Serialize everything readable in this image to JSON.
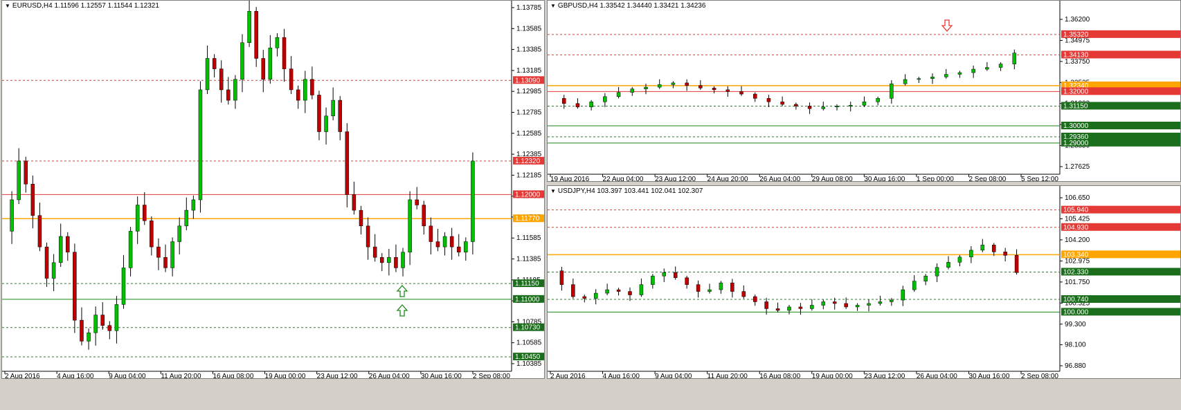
{
  "charts": [
    {
      "id": "eurusd",
      "title": "EURUSD,H4  1.11596 1.12557 1.11544 1.12321",
      "price_axis": [
        "1.13785",
        "1.13585",
        "1.13385",
        "1.13185",
        "1.12985",
        "1.12785",
        "1.12585",
        "1.12385",
        "1.12185",
        "1.11985",
        "1.11785",
        "1.11585",
        "1.11385",
        "1.11185",
        "1.10985",
        "1.10785",
        "1.10585",
        "1.10385"
      ],
      "time_axis": [
        "2 Aug 2016",
        "4 Aug 16:00",
        "9 Aug 04:00",
        "11 Aug 20:00",
        "16 Aug 08:00",
        "19 Aug 00:00",
        "23 Aug 12:00",
        "26 Aug 04:00",
        "30 Aug 16:00",
        "2 Sep 08:00"
      ],
      "levels": [
        {
          "value": "1.13090",
          "color": "#e53935",
          "style": "dashed",
          "tag_bg": "#e53935"
        },
        {
          "value": "1.12320",
          "color": "#e53935",
          "style": "dashed",
          "tag_bg": "#e53935"
        },
        {
          "value": "1.12000",
          "color": "#e53935",
          "style": "solid",
          "tag_bg": "#e53935"
        },
        {
          "value": "1.11770",
          "color": "#ffa500",
          "style": "solid",
          "tag_bg": "#ffa500"
        },
        {
          "value": "1.11150",
          "color": "#1b8a1b",
          "style": "dashed",
          "tag_bg": "#1b6e1b"
        },
        {
          "value": "1.11000",
          "color": "#1b8a1b",
          "style": "solid",
          "tag_bg": "#1b6e1b"
        },
        {
          "value": "1.10730",
          "color": "#1b8a1b",
          "style": "dashed",
          "tag_bg": "#1b6e1b"
        },
        {
          "value": "1.10450",
          "color": "#1b8a1b",
          "style": "dashed",
          "tag_bg": "#1b6e1b"
        }
      ],
      "arrows": [
        {
          "direction": "up",
          "color": "#1b8a1b"
        },
        {
          "direction": "up",
          "color": "#1b8a1b"
        }
      ],
      "path": [
        1.1165,
        1.1195,
        1.1232,
        1.121,
        1.118,
        1.115,
        1.112,
        1.1135,
        1.116,
        1.1145,
        1.108,
        1.106,
        1.1068,
        1.1085,
        1.1075,
        1.107,
        1.1095,
        1.113,
        1.1165,
        1.119,
        1.1175,
        1.115,
        1.114,
        1.113,
        1.1155,
        1.117,
        1.1185,
        1.1195,
        1.13,
        1.133,
        1.132,
        1.13,
        1.129,
        1.131,
        1.1345,
        1.1375,
        1.133,
        1.131,
        1.134,
        1.135,
        1.132,
        1.13,
        1.129,
        1.131,
        1.1295,
        1.126,
        1.1275,
        1.129,
        1.126,
        1.12,
        1.1185,
        1.117,
        1.115,
        1.114,
        1.1135,
        1.114,
        1.113,
        1.1145,
        1.1195,
        1.119,
        1.117,
        1.1155,
        1.115,
        1.116,
        1.115,
        1.1145,
        1.1155,
        1.1232
      ]
    },
    {
      "id": "gbpusd",
      "title": "GBPUSD,H4  1.33542 1.34440 1.33421 1.34236",
      "price_axis": [
        "1.36200",
        "1.34975",
        "1.33750",
        "1.32525",
        "1.31300",
        "1.30075",
        "1.28850",
        "1.27625"
      ],
      "time_axis": [
        "19 Aug 2016",
        "22 Aug 04:00",
        "23 Aug 12:00",
        "24 Aug 20:00",
        "26 Aug 04:00",
        "29 Aug 08:00",
        "30 Aug 16:00",
        "1 Sep 00:00",
        "2 Sep 08:00",
        "5 Sep 12:00"
      ],
      "levels": [
        {
          "value": "1.35320",
          "color": "#e53935",
          "style": "dashed",
          "tag_bg": "#e53935"
        },
        {
          "value": "1.34130",
          "color": "#e53935",
          "style": "dashed",
          "tag_bg": "#e53935"
        },
        {
          "value": "1.32340",
          "color": "#ffa500",
          "style": "solid",
          "tag_bg": "#ffa500"
        },
        {
          "value": "1.32000",
          "color": "#e53935",
          "style": "solid",
          "tag_bg": "#e53935"
        },
        {
          "value": "1.31150",
          "color": "#1b8a1b",
          "style": "dashed",
          "tag_bg": "#1b6e1b"
        },
        {
          "value": "1.30000",
          "color": "#1b8a1b",
          "style": "solid",
          "tag_bg": "#1b6e1b"
        },
        {
          "value": "1.29360",
          "color": "#1b8a1b",
          "style": "dashed",
          "tag_bg": "#1b6e1b"
        },
        {
          "value": "1.29000",
          "color": "#1b8a1b",
          "style": "solid",
          "tag_bg": "#1b6e1b"
        }
      ],
      "arrows": [
        {
          "direction": "down",
          "color": "#e53935"
        }
      ],
      "path": [
        1.316,
        1.313,
        1.311,
        1.314,
        1.317,
        1.3195,
        1.3215,
        1.3225,
        1.324,
        1.325,
        1.3235,
        1.322,
        1.321,
        1.32,
        1.3185,
        1.316,
        1.314,
        1.3125,
        1.3115,
        1.31,
        1.311,
        1.3115,
        1.312,
        1.314,
        1.316,
        1.3245,
        1.327,
        1.3275,
        1.3285,
        1.33,
        1.331,
        1.333,
        1.334,
        1.336,
        1.3424
      ]
    },
    {
      "id": "usdjpy",
      "title": "USDJPY,H4  103.397 103.441 102.041 102.307",
      "price_axis": [
        "106.650",
        "105.425",
        "104.200",
        "102.975",
        "101.750",
        "100.525",
        "99.300",
        "98.100",
        "96.880"
      ],
      "time_axis": [
        "2 Aug 2016",
        "4 Aug 16:00",
        "9 Aug 04:00",
        "11 Aug 20:00",
        "16 Aug 08:00",
        "19 Aug 00:00",
        "23 Aug 12:00",
        "26 Aug 04:00",
        "30 Aug 16:00",
        "2 Sep 08:00"
      ],
      "levels": [
        {
          "value": "105.940",
          "color": "#e53935",
          "style": "dashed",
          "tag_bg": "#e53935"
        },
        {
          "value": "104.930",
          "color": "#e53935",
          "style": "dashed",
          "tag_bg": "#e53935"
        },
        {
          "value": "103.340",
          "color": "#ffa500",
          "style": "solid",
          "tag_bg": "#ffa500"
        },
        {
          "value": "102.330",
          "color": "#1b8a1b",
          "style": "dashed",
          "tag_bg": "#1b6e1b"
        },
        {
          "value": "100.740",
          "color": "#1b8a1b",
          "style": "dashed",
          "tag_bg": "#1b6e1b"
        },
        {
          "value": "100.000",
          "color": "#1b8a1b",
          "style": "solid",
          "tag_bg": "#1b6e1b"
        }
      ],
      "arrows": [],
      "path": [
        102.4,
        101.6,
        100.9,
        100.8,
        101.1,
        101.3,
        101.2,
        101.0,
        101.6,
        102.1,
        102.3,
        102.0,
        101.6,
        101.2,
        101.3,
        101.7,
        101.2,
        100.9,
        100.6,
        100.2,
        100.1,
        100.3,
        100.2,
        100.4,
        100.6,
        100.5,
        100.3,
        100.4,
        100.5,
        100.6,
        100.7,
        101.3,
        101.8,
        102.1,
        102.6,
        102.9,
        103.2,
        103.6,
        103.9,
        103.5,
        103.3,
        102.3
      ]
    }
  ]
}
